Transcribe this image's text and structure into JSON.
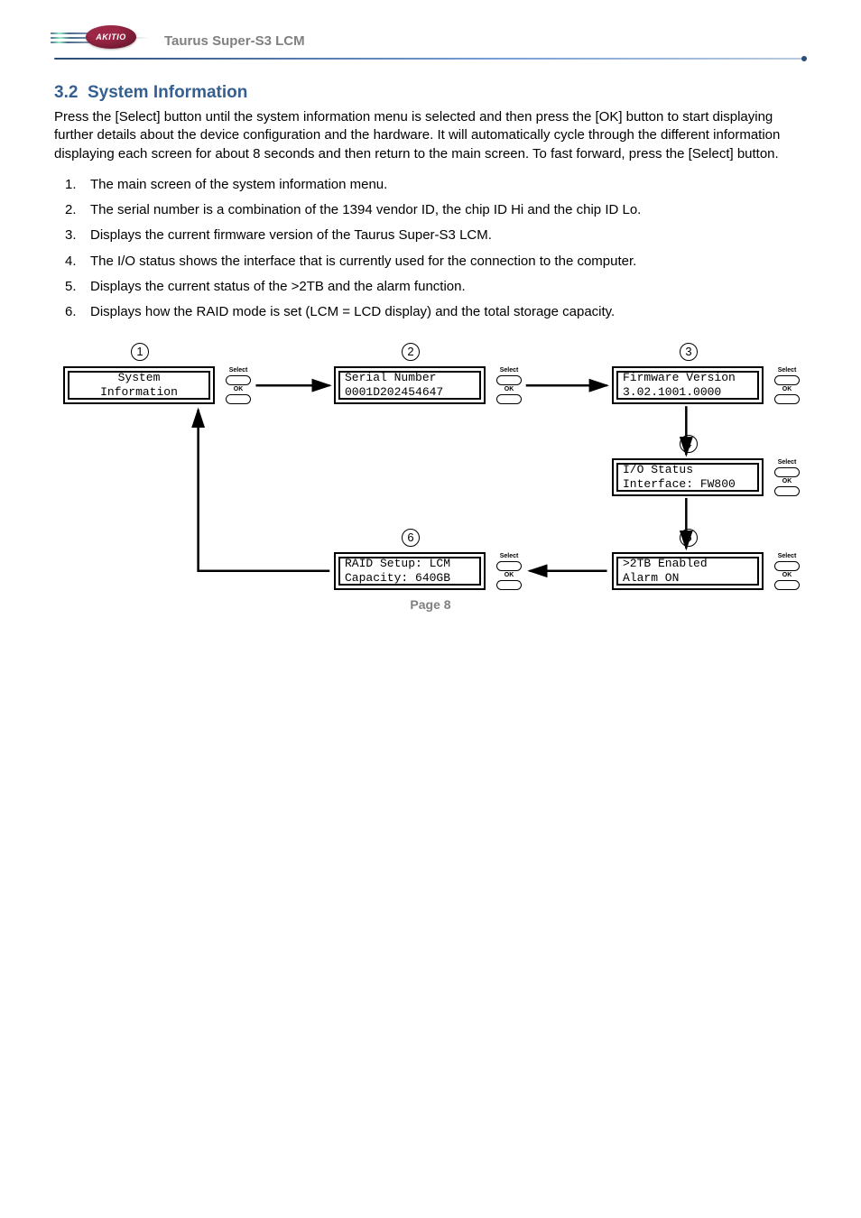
{
  "header": {
    "logo_text": "AKITIO",
    "product": "Taurus Super-S3 LCM"
  },
  "section": {
    "number": "3.2",
    "title": "System Information"
  },
  "intro": "Press the [Select] button until the system information menu is selected and then press the [OK] button to start displaying further details about the device configuration and the hardware. It will automatically cycle through the different information displaying each screen for about 8 seconds and then return to the main screen. To fast forward, press the [Select] button.",
  "list": [
    "The main screen of the system information menu.",
    "The serial number is a combination of the 1394 vendor ID, the chip ID Hi and the chip ID Lo.",
    "Displays the current firmware version of the Taurus Super-S3 LCM.",
    "The I/O status shows the interface that is currently used for the connection to the computer.",
    "Displays the current status of the >2TB and the alarm function.",
    "Displays how the RAID mode is set (LCM = LCD display) and the total storage capacity."
  ],
  "diagram": {
    "btn_select": "Select",
    "btn_ok": "OK",
    "screens": {
      "s1_line1": "System",
      "s1_line2": "Information",
      "s2_line1": "Serial Number",
      "s2_line2": "0001D202454647",
      "s3_line1": "Firmware Version",
      "s3_line2": "3.02.1001.0000",
      "s4_line1": "I/O Status",
      "s4_line2": "Interface: FW800",
      "s5_line1": ">2TB Enabled",
      "s5_line2": "Alarm ON",
      "s6_line1": "RAID Setup: LCM",
      "s6_line2": "Capacity: 640GB"
    },
    "nums": {
      "n1": "1",
      "n2": "2",
      "n3": "3",
      "n4": "4",
      "n5": "5",
      "n6": "6"
    }
  },
  "footer": "Page 8"
}
